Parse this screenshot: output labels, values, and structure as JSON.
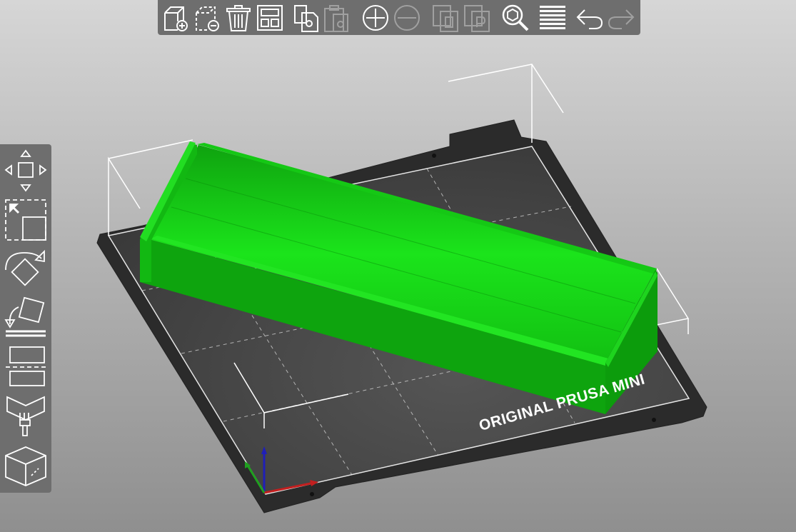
{
  "colors": {
    "background_top": "#d6d6d6",
    "background_bottom": "#8f8f8f",
    "toolbar_bg": "#6e6e6e",
    "bed_plate": "#2b2b2b",
    "bed_surface": "#444444",
    "model_green": "#19d119",
    "model_green_dark": "#0ea40e",
    "axis_x": "#c21f1f",
    "axis_y": "#1fa01f",
    "axis_z": "#1f1fb8"
  },
  "top_toolbar": {
    "items": [
      {
        "icon": "add-object-icon",
        "enabled": true
      },
      {
        "icon": "delete-object-icon",
        "enabled": true
      },
      {
        "icon": "delete-all-icon",
        "enabled": true
      },
      {
        "icon": "arrange-icon",
        "enabled": true
      },
      {
        "icon": "copy-icon",
        "enabled": true
      },
      {
        "icon": "paste-icon",
        "enabled": false
      },
      {
        "icon": "add-instance-icon",
        "enabled": true
      },
      {
        "icon": "remove-instance-icon",
        "enabled": false
      },
      {
        "icon": "split-objects-icon",
        "enabled": false
      },
      {
        "icon": "split-parts-icon",
        "enabled": false
      },
      {
        "icon": "search-icon",
        "enabled": true
      },
      {
        "icon": "layers-icon",
        "enabled": true
      },
      {
        "icon": "undo-icon",
        "enabled": true
      },
      {
        "icon": "redo-icon",
        "enabled": false
      }
    ]
  },
  "left_toolbar": {
    "items": [
      {
        "icon": "move-icon"
      },
      {
        "icon": "scale-icon"
      },
      {
        "icon": "rotate-icon"
      },
      {
        "icon": "place-on-face-icon"
      },
      {
        "icon": "cut-icon"
      },
      {
        "icon": "paint-supports-icon"
      },
      {
        "icon": "view-cube-icon"
      }
    ]
  },
  "bed": {
    "label": "ORIGINAL PRUSA MINI"
  }
}
